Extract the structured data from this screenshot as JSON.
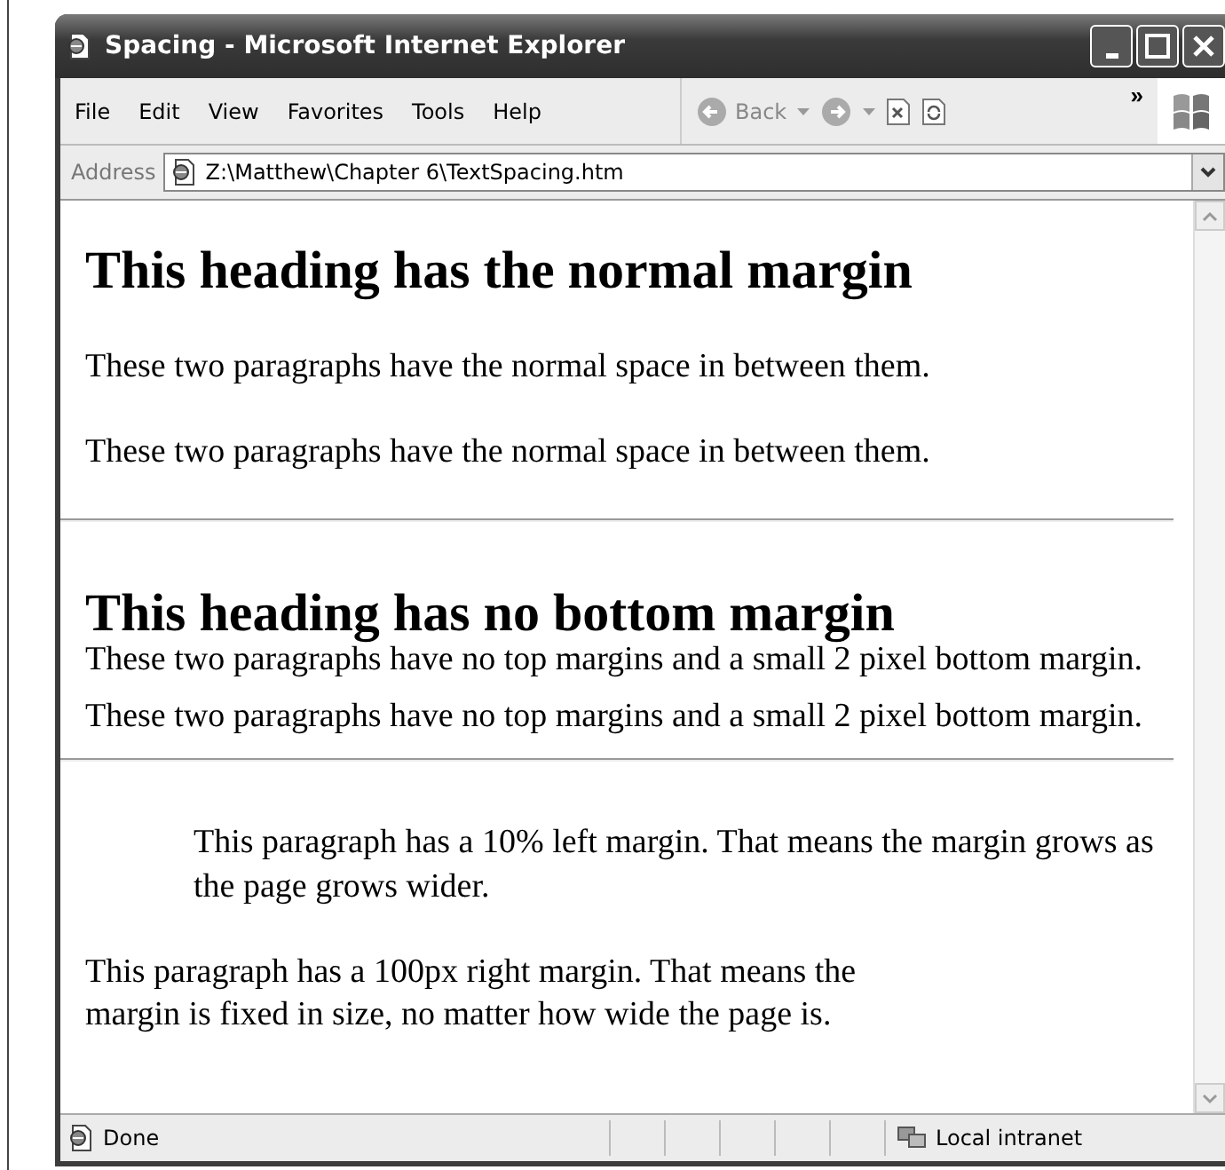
{
  "window": {
    "title": "Spacing - Microsoft Internet Explorer"
  },
  "menu": [
    "File",
    "Edit",
    "View",
    "Favorites",
    "Tools",
    "Help"
  ],
  "toolbar": {
    "back": "Back",
    "overflow": "»"
  },
  "address": {
    "label": "Address",
    "value": "Z:\\Matthew\\Chapter 6\\TextSpacing.htm"
  },
  "content": [
    {
      "kind": "heading",
      "text": "This heading has the normal margin"
    },
    {
      "kind": "para",
      "text": "These two paragraphs have the normal space in between them."
    },
    {
      "kind": "para",
      "text": "These two paragraphs have the normal space in between them."
    },
    {
      "kind": "rule"
    },
    {
      "kind": "heading-tight",
      "text": "This heading has no bottom margin"
    },
    {
      "kind": "para-tight",
      "text": "These two paragraphs have no top margins and a small 2 pixel bottom margin."
    },
    {
      "kind": "para-tight",
      "text": "These two paragraphs have no top margins and a small 2 pixel bottom margin."
    },
    {
      "kind": "rule"
    },
    {
      "kind": "para-indent",
      "text": "This paragraph has a 10% left margin. That means the margin grows as the page grows wider."
    },
    {
      "kind": "para-right",
      "text": "This paragraph has a 100px right margin. That means the margin is fixed in size, no matter how wide the page is."
    }
  ],
  "status": {
    "text": "Done",
    "zone": "Local intranet"
  }
}
